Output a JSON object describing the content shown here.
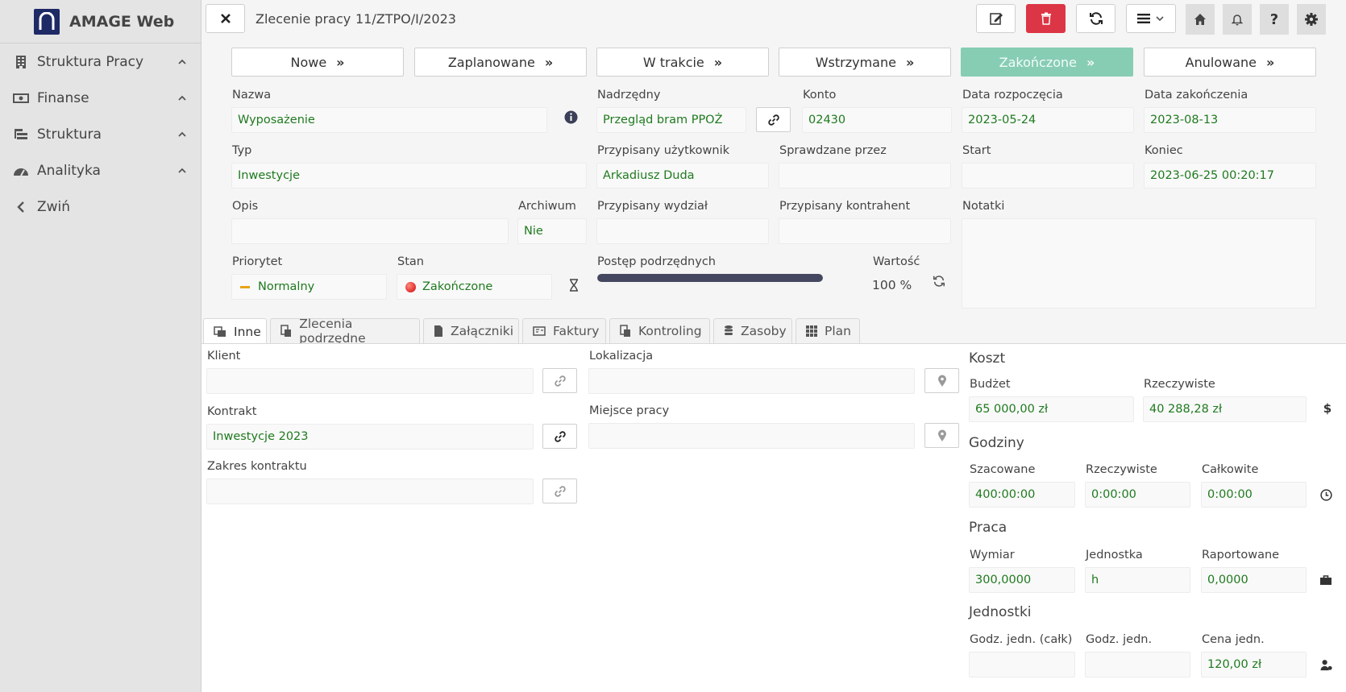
{
  "app": {
    "brand": "AMAGE Web"
  },
  "sidebar": {
    "items": [
      {
        "label": "Struktura Pracy",
        "icon": "building-icon"
      },
      {
        "label": "Finanse",
        "icon": "money-icon"
      },
      {
        "label": "Struktura",
        "icon": "tree-structure-icon"
      },
      {
        "label": "Analityka",
        "icon": "gauge-icon"
      },
      {
        "label": "Zwiń",
        "icon": "chevron-left-icon"
      }
    ]
  },
  "header": {
    "type": "Zlecenie pracy",
    "number": "11/ZTPO/I/2023"
  },
  "statuses": [
    {
      "label": "Nowe",
      "active": false
    },
    {
      "label": "Zaplanowane",
      "active": false
    },
    {
      "label": "W trakcie",
      "active": false
    },
    {
      "label": "Wstrzymane",
      "active": false
    },
    {
      "label": "Zakończone",
      "active": true
    },
    {
      "label": "Anulowane",
      "active": false
    }
  ],
  "form": {
    "nazwa": {
      "label": "Nazwa",
      "value": "Wyposażenie"
    },
    "nadrzedny": {
      "label": "Nadrzędny",
      "value": "Przegląd bram PPOŻ"
    },
    "konto": {
      "label": "Konto",
      "value": "02430"
    },
    "data_rozpoczecia": {
      "label": "Data rozpoczęcia",
      "value": "2023-05-24"
    },
    "data_zakonczenia": {
      "label": "Data zakończenia",
      "value": "2023-08-13"
    },
    "typ": {
      "label": "Typ",
      "value": "Inwestycje"
    },
    "przypisany_uzytkownik": {
      "label": "Przypisany użytkownik",
      "value": "Arkadiusz Duda"
    },
    "sprawdzane_przez": {
      "label": "Sprawdzane przez",
      "value": ""
    },
    "start": {
      "label": "Start",
      "value": ""
    },
    "koniec": {
      "label": "Koniec",
      "value": "2023-06-25 00:20:17"
    },
    "opis": {
      "label": "Opis",
      "value": ""
    },
    "archiwum": {
      "label": "Archiwum",
      "value": "Nie"
    },
    "przypisany_wydzial": {
      "label": "Przypisany wydział",
      "value": ""
    },
    "przypisany_kontrahent": {
      "label": "Przypisany kontrahent",
      "value": ""
    },
    "notatki": {
      "label": "Notatki",
      "value": ""
    },
    "priorytet": {
      "label": "Priorytet",
      "value": "Normalny",
      "color": "#e8a317"
    },
    "stan": {
      "label": "Stan",
      "value": "Zakończone",
      "color": "#e53935"
    },
    "postep": {
      "label": "Postęp podrzędnych",
      "value": 1.0
    },
    "wartosc": {
      "label": "Wartość",
      "value": "100 %"
    }
  },
  "tabs": [
    {
      "label": "Inne",
      "icon": "info-panel-icon",
      "active": true
    },
    {
      "label": "Zlecenia podrzędne",
      "icon": "sub-orders-icon",
      "active": false
    },
    {
      "label": "Załączniki",
      "icon": "attachment-file-icon",
      "active": false
    },
    {
      "label": "Faktury",
      "icon": "invoice-icon",
      "active": false
    },
    {
      "label": "Kontroling",
      "icon": "controlling-icon",
      "active": false
    },
    {
      "label": "Zasoby",
      "icon": "database-icon",
      "active": false
    },
    {
      "label": "Plan",
      "icon": "grid-plan-icon",
      "active": false
    }
  ],
  "inne": {
    "klient": {
      "label": "Klient",
      "value": ""
    },
    "lokalizacja": {
      "label": "Lokalizacja",
      "value": ""
    },
    "kontrakt": {
      "label": "Kontrakt",
      "value": "Inwestycje 2023"
    },
    "miejsce_pracy": {
      "label": "Miejsce pracy",
      "value": ""
    },
    "zakres_kontraktu": {
      "label": "Zakres kontraktu",
      "value": ""
    }
  },
  "koszt": {
    "title": "Koszt",
    "budzet": {
      "label": "Budżet",
      "value": "65 000,00 zł"
    },
    "rzeczywiste": {
      "label": "Rzeczywiste",
      "value": "40 288,28 zł"
    }
  },
  "godziny": {
    "title": "Godziny",
    "szacowane": {
      "label": "Szacowane",
      "value": "400:00:00"
    },
    "rzeczywiste": {
      "label": "Rzeczywiste",
      "value": "0:00:00"
    },
    "calkowite": {
      "label": "Całkowite",
      "value": "0:00:00"
    }
  },
  "praca": {
    "title": "Praca",
    "wymiar": {
      "label": "Wymiar",
      "value": "300,0000"
    },
    "jednostka": {
      "label": "Jednostka",
      "value": "h"
    },
    "raportowane": {
      "label": "Raportowane",
      "value": "0,0000"
    }
  },
  "jednostki": {
    "title": "Jednostki",
    "godz_jedn_calk": {
      "label": "Godz. jedn. (całk)",
      "value": ""
    },
    "godz_jedn": {
      "label": "Godz. jedn.",
      "value": ""
    },
    "cena_jedn": {
      "label": "Cena jedn.",
      "value": "120,00 zł"
    }
  }
}
